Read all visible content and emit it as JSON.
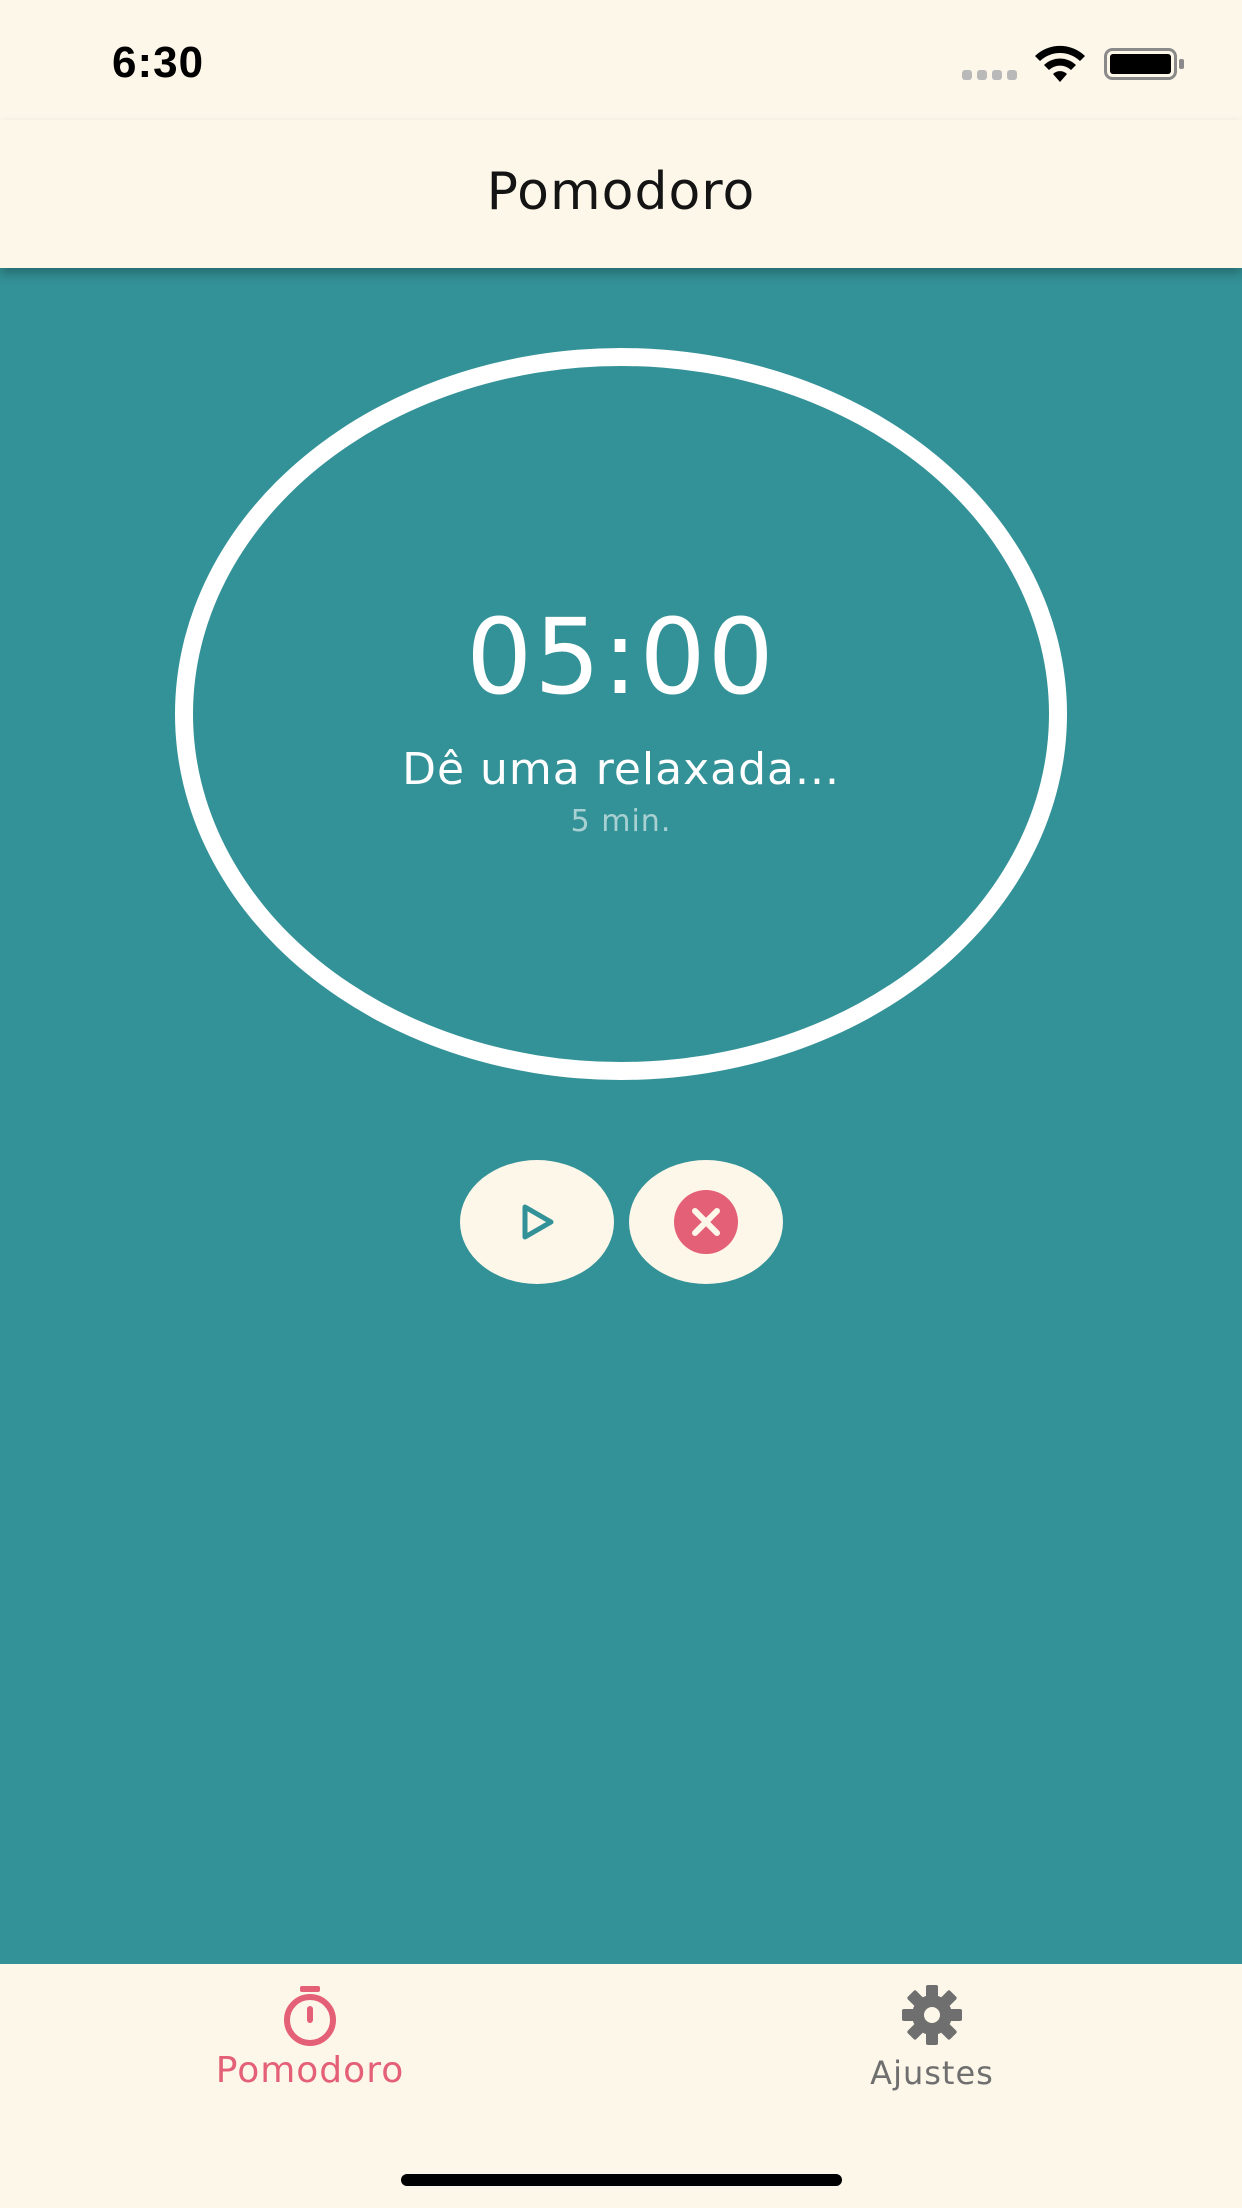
{
  "status_bar": {
    "time": "6:30"
  },
  "header": {
    "title": "Pomodoro"
  },
  "timer": {
    "value": "05:00",
    "message": "Dê uma relaxada...",
    "duration": "5 min."
  },
  "controls": {
    "play_icon": "play-icon",
    "stop_icon": "close-circle-icon"
  },
  "tabs": [
    {
      "label": "Pomodoro",
      "icon": "stopwatch-icon",
      "active": true
    },
    {
      "label": "Ajustes",
      "icon": "gear-icon",
      "active": false
    }
  ],
  "colors": {
    "background": "#fdf7ea",
    "teal": "#339297",
    "accent": "#e46077",
    "inactive": "#6f6f6f"
  }
}
